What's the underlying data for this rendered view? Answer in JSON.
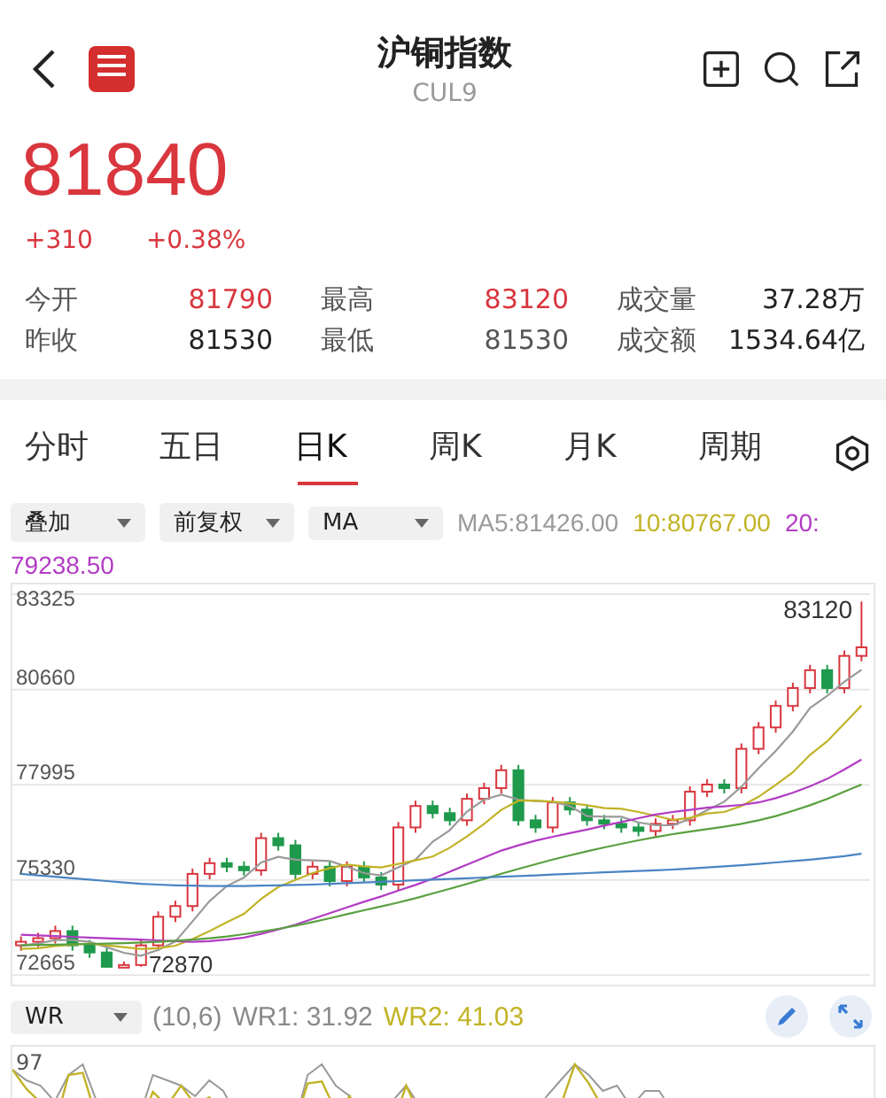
{
  "header": {
    "title": "沪铜指数",
    "code": "CUL9",
    "price": "81840",
    "change": "+310",
    "change_pct": "+0.38%"
  },
  "stats": [
    {
      "label": "今开",
      "value": "81790",
      "color": "#d9363e"
    },
    {
      "label": "最高",
      "value": "83120",
      "color": "#d9363e"
    },
    {
      "label": "成交量",
      "value": "37.28万",
      "color": "#222222"
    },
    {
      "label": "昨收",
      "value": "81530",
      "color": "#222222"
    },
    {
      "label": "最低",
      "value": "81530",
      "color": "#555555"
    },
    {
      "label": "成交额",
      "value": "1534.64亿",
      "color": "#222222"
    }
  ],
  "tabs": [
    {
      "label": "分时",
      "selected": false
    },
    {
      "label": "五日",
      "selected": false
    },
    {
      "label": "日K",
      "selected": true
    },
    {
      "label": "周K",
      "selected": false
    },
    {
      "label": "月K",
      "selected": false
    },
    {
      "label": "周期",
      "selected": false
    }
  ],
  "selectors": [
    "叠加",
    "前复权",
    "MA"
  ],
  "ma_legend": [
    {
      "text": "MA5:81426.00",
      "color": "#9a9a9a"
    },
    {
      "text": "10:80767.00",
      "color": "#c2b326"
    },
    {
      "text": "20:",
      "color": "#b23cc4"
    },
    {
      "text": "79238.50",
      "color": "#b23cc4"
    }
  ],
  "chart": {
    "high_tag": "83120",
    "low_tag": "72870",
    "chart_data": {
      "type": "candlestick",
      "ylim": [
        72400,
        83600
      ],
      "grid": true,
      "yticks": [
        83325,
        80660,
        77995,
        75330,
        72665
      ],
      "ohlc": [
        [
          73500,
          73750,
          73350,
          73600
        ],
        [
          73600,
          73850,
          73450,
          73700
        ],
        [
          73700,
          74050,
          73550,
          73900
        ],
        [
          73900,
          74050,
          73350,
          73500
        ],
        [
          73500,
          73650,
          73150,
          73300
        ],
        [
          73300,
          73450,
          72880,
          72900
        ],
        [
          72900,
          73050,
          72870,
          72950
        ],
        [
          72950,
          73650,
          72900,
          73500
        ],
        [
          73500,
          74450,
          73350,
          74300
        ],
        [
          74300,
          74750,
          74150,
          74600
        ],
        [
          74600,
          75650,
          74450,
          75500
        ],
        [
          75500,
          75950,
          75350,
          75800
        ],
        [
          75800,
          75950,
          75550,
          75700
        ],
        [
          75700,
          75850,
          75450,
          75600
        ],
        [
          75600,
          76650,
          75450,
          76500
        ],
        [
          76500,
          76650,
          76150,
          76300
        ],
        [
          76300,
          76450,
          75350,
          75500
        ],
        [
          75500,
          75850,
          75350,
          75700
        ],
        [
          75700,
          75850,
          75150,
          75300
        ],
        [
          75300,
          75850,
          75150,
          75700
        ],
        [
          75700,
          75850,
          75250,
          75400
        ],
        [
          75400,
          75550,
          75050,
          75200
        ],
        [
          75200,
          76950,
          75050,
          76800
        ],
        [
          76800,
          77550,
          76650,
          77400
        ],
        [
          77400,
          77550,
          77050,
          77200
        ],
        [
          77200,
          77350,
          76850,
          77000
        ],
        [
          77000,
          77750,
          76850,
          77600
        ],
        [
          77600,
          78050,
          77450,
          77900
        ],
        [
          77900,
          78550,
          77750,
          78400
        ],
        [
          78400,
          78550,
          76850,
          77000
        ],
        [
          77000,
          77150,
          76650,
          76800
        ],
        [
          76800,
          77650,
          76650,
          77500
        ],
        [
          77500,
          77650,
          77150,
          77300
        ],
        [
          77300,
          77450,
          76850,
          77000
        ],
        [
          77000,
          77150,
          76750,
          76900
        ],
        [
          76900,
          77050,
          76650,
          76800
        ],
        [
          76800,
          76950,
          76550,
          76700
        ],
        [
          76700,
          77050,
          76550,
          76900
        ],
        [
          76900,
          77150,
          76750,
          77000
        ],
        [
          77000,
          77950,
          76850,
          77800
        ],
        [
          77800,
          78150,
          77650,
          78000
        ],
        [
          78000,
          78150,
          77750,
          77900
        ],
        [
          77900,
          79150,
          77750,
          79000
        ],
        [
          79000,
          79750,
          78850,
          79600
        ],
        [
          79600,
          80350,
          79450,
          80200
        ],
        [
          80200,
          80850,
          80050,
          80700
        ],
        [
          80700,
          81350,
          80550,
          81200
        ],
        [
          81200,
          81350,
          80550,
          80700
        ],
        [
          80700,
          81750,
          80550,
          81600
        ],
        [
          81600,
          83120,
          81450,
          81840
        ]
      ]
    },
    "averages": {
      "chart_data": {
        "type": "line",
        "ylim": [
          72400,
          83600
        ],
        "series": [
          {
            "color": "#9a9a9a",
            "values": [
              73500,
              73550,
              73650,
              73650,
              73600,
              73450,
              73290,
              73210,
              73370,
              73610,
              74170,
              74740,
              75160,
              75400,
              75820,
              75980,
              75900,
              75880,
              75860,
              75700,
              75520,
              75460,
              75680,
              75900,
              76400,
              76720,
              77240,
              77580,
              77720,
              77580,
              77540,
              77520,
              77400,
              77120,
              77100,
              77100,
              76940,
              76860,
              76860,
              77040,
              77280,
              77520,
              77940,
              78460,
              78940,
              79480,
              80140,
              80480,
              80880,
              81210
            ]
          },
          {
            "color": "#c2b326",
            "values": [
              73400,
              73420,
              73480,
              73520,
              73550,
              73500,
              73450,
              73400,
              73420,
              73490,
              73680,
              73900,
              74150,
              74380,
              74800,
              75130,
              75330,
              75520,
              75660,
              75760,
              75710,
              75680,
              75780,
              75880,
              75990,
              76230,
              76550,
              76900,
              77290,
              77550,
              77550,
              77520,
              77480,
              77420,
              77340,
              77320,
              77230,
              77130,
              77010,
              77070,
              77190,
              77230,
              77400,
              77660,
              77990,
              78340,
              78830,
              79210,
              79710,
              80210
            ]
          },
          {
            "color": "#b23cc4",
            "values": [
              73800,
              73780,
              73760,
              73740,
              73720,
              73700,
              73680,
              73660,
              73640,
              73620,
              73600,
              73620,
              73660,
              73720,
              73820,
              73940,
              74080,
              74240,
              74400,
              74560,
              74720,
              74870,
              75030,
              75190,
              75370,
              75560,
              75760,
              75960,
              76150,
              76300,
              76430,
              76540,
              76640,
              76740,
              76850,
              76950,
              77060,
              77160,
              77230,
              77290,
              77350,
              77390,
              77430,
              77500,
              77620,
              77770,
              77950,
              78160,
              78420,
              78700
            ]
          },
          {
            "color": "#5aa040",
            "values": [
              73500,
              73510,
              73520,
              73530,
              73540,
              73550,
              73560,
              73580,
              73600,
              73630,
              73660,
              73700,
              73750,
              73810,
              73880,
              73960,
              74050,
              74150,
              74260,
              74370,
              74480,
              74590,
              74700,
              74820,
              74950,
              75080,
              75220,
              75360,
              75500,
              75640,
              75770,
              75900,
              76020,
              76130,
              76240,
              76340,
              76440,
              76530,
              76610,
              76680,
              76750,
              76820,
              76900,
              77000,
              77120,
              77260,
              77420,
              77600,
              77800,
              78000
            ]
          },
          {
            "color": "#4a84c4",
            "values": [
              75500,
              75460,
              75420,
              75380,
              75340,
              75300,
              75260,
              75220,
              75200,
              75180,
              75170,
              75160,
              75160,
              75160,
              75170,
              75180,
              75190,
              75200,
              75220,
              75240,
              75260,
              75280,
              75300,
              75320,
              75340,
              75360,
              75380,
              75400,
              75420,
              75440,
              75460,
              75480,
              75500,
              75520,
              75540,
              75560,
              75580,
              75600,
              75620,
              75650,
              75680,
              75710,
              75740,
              75780,
              75820,
              75860,
              75900,
              75950,
              76000,
              76060
            ]
          }
        ]
      }
    }
  },
  "indicator": {
    "selector": "WR",
    "params": "(10,6)",
    "values": [
      {
        "text": "WR1: 31.92",
        "color": "#8a8a8a"
      },
      {
        "text": "WR2: 41.03",
        "color": "#c2b326"
      }
    ],
    "top_label": "97"
  }
}
